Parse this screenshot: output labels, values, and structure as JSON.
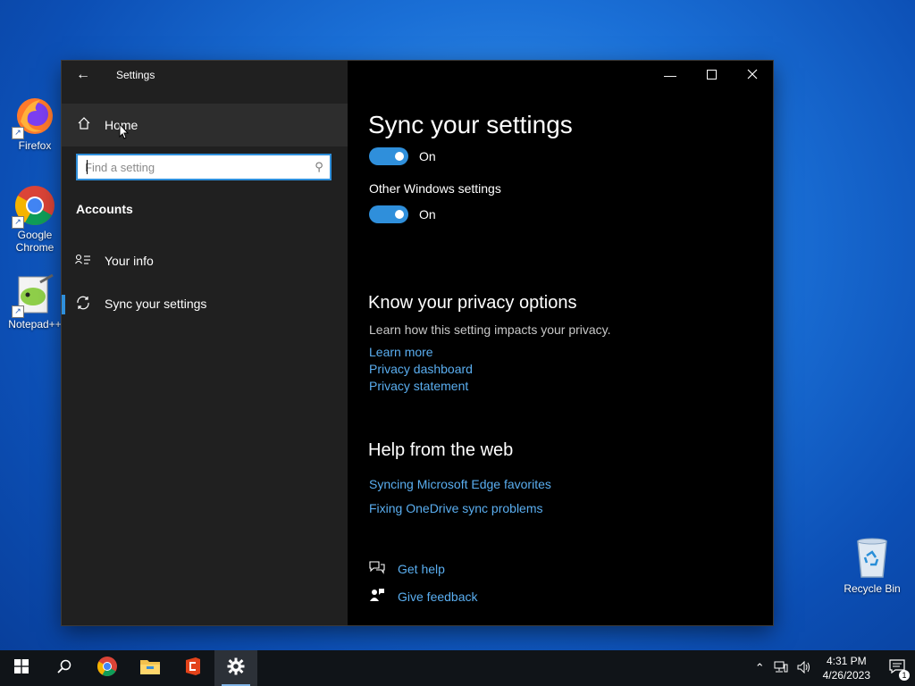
{
  "desktop": {
    "icons": [
      {
        "label": "Firefox"
      },
      {
        "label": "Google Chrome"
      },
      {
        "label": "Notepad++"
      },
      {
        "label": "Recycle Bin"
      }
    ]
  },
  "window": {
    "title": "Settings",
    "nav": {
      "home_label": "Home",
      "search_placeholder": "Find a setting",
      "section_title": "Accounts",
      "items": [
        {
          "label": "Your info",
          "icon": "contact-card-icon"
        },
        {
          "label": "Sync your settings",
          "icon": "sync-icon",
          "selected": true
        }
      ]
    },
    "content": {
      "page_title": "Sync your settings",
      "toggle1_state": "On",
      "other_label": "Other Windows settings",
      "toggle2_state": "On",
      "privacy_heading": "Know your privacy options",
      "privacy_desc": "Learn how this setting impacts your privacy.",
      "privacy_links": [
        "Learn more",
        "Privacy dashboard",
        "Privacy statement"
      ],
      "help_heading": "Help from the web",
      "help_links": [
        "Syncing Microsoft Edge favorites",
        "Fixing OneDrive sync problems"
      ],
      "get_help": "Get help",
      "give_feedback": "Give feedback"
    }
  },
  "taskbar": {
    "time": "4:31 PM",
    "date": "4/26/2023",
    "notification_count": "1"
  },
  "colors": {
    "accent": "#2f8fdb",
    "link": "#5aaef0",
    "nav_bg": "#202020",
    "content_bg": "#000000"
  }
}
